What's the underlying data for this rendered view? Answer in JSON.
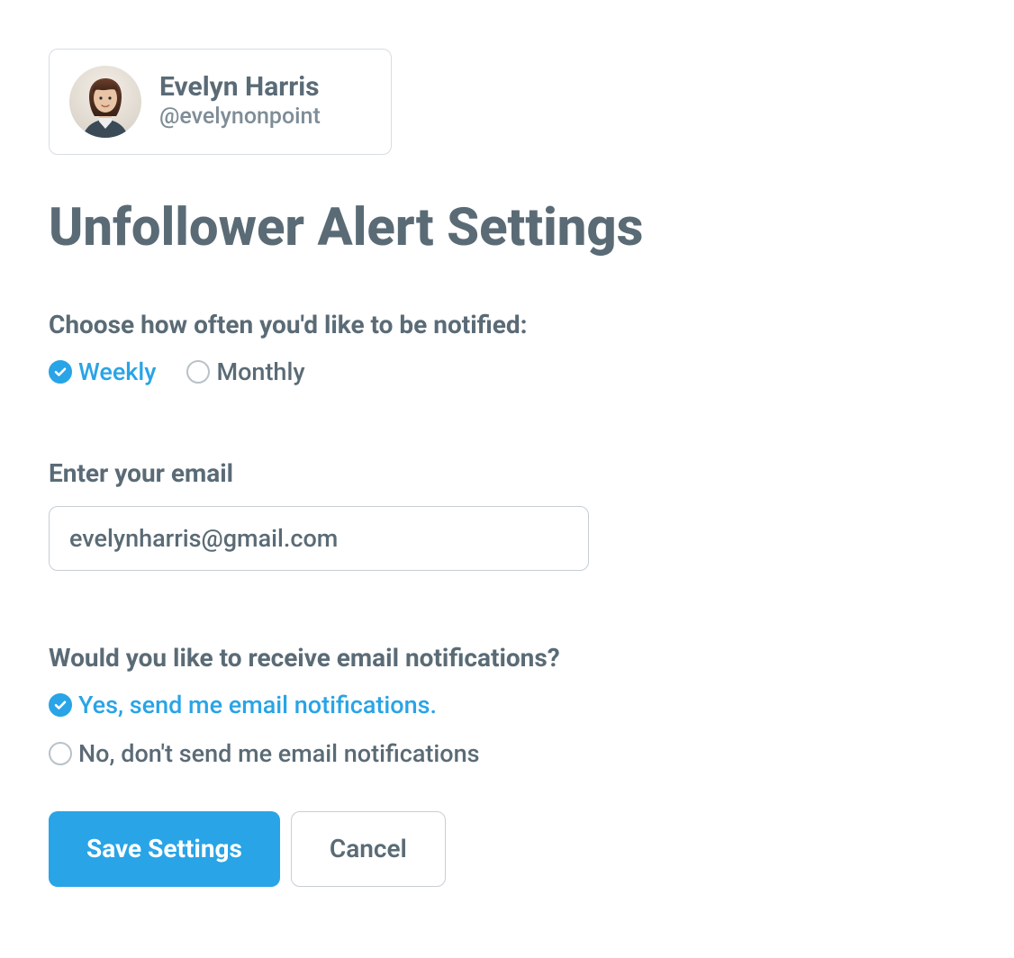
{
  "user": {
    "name": "Evelyn Harris",
    "handle": "@evelynonpoint"
  },
  "page": {
    "title": "Unfollower Alert Settings"
  },
  "frequency": {
    "question": "Choose how often you'd like to be notified:",
    "options": {
      "weekly": "Weekly",
      "monthly": "Monthly"
    },
    "selected": "weekly"
  },
  "email": {
    "label": "Enter your email",
    "value": "evelynharris@gmail.com"
  },
  "notifications": {
    "question": "Would you like to receive email notifications?",
    "options": {
      "yes": "Yes, send me email notifications.",
      "no": "No, don't send me email notifications"
    },
    "selected": "yes"
  },
  "buttons": {
    "save": "Save Settings",
    "cancel": "Cancel"
  },
  "colors": {
    "accent": "#29a4e6",
    "text": "#5a6b76",
    "muted": "#7e8d97",
    "border": "#c7ced3"
  }
}
